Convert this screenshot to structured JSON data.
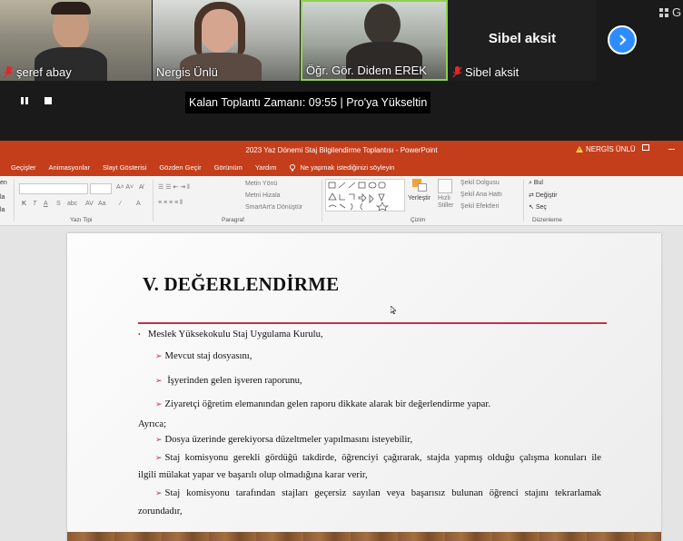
{
  "zoom": {
    "participants": [
      {
        "name": "şeref abay",
        "muted": true
      },
      {
        "name": "Nergis Ünlü",
        "muted": false
      },
      {
        "name": "Öğr. Gör. Didem EREK",
        "muted": true,
        "active_speaker": true
      },
      {
        "name": "Sibel aksit",
        "muted": true
      }
    ],
    "grid_label": "G",
    "meeting_time": "Kalan Toplantı Zamanı: 09:55 | Pro'ya Yükseltin"
  },
  "powerpoint": {
    "window_title": "2023 Yaz Dönemi Staj Bilgilendirme Toplantısı  -  PowerPoint",
    "user": "NERGİS ÜNLÜ",
    "tabs": [
      "Geçişler",
      "Animasyonlar",
      "Slayt Gösterisi",
      "Gözden Geçir",
      "Görünüm",
      "Yardım"
    ],
    "tell_me": "Ne yapmak istediğinizi söyleyin",
    "ribbon": {
      "left_clip": [
        "en",
        "la",
        "la"
      ],
      "groups": [
        "Yazı Tipi",
        "Paragraf",
        "Çizim",
        "Düzenleme"
      ],
      "paragraph": {
        "text_direction": "Metin Yönü",
        "align_text": "Metni Hizala",
        "smartart": "SmartArt'a Dönüştür"
      },
      "drawing": {
        "arrange": "Yerleştir",
        "quick_styles": "Hızlı Stiller",
        "shape_fill": "Şekil Dolgusu",
        "shape_outline": "Şekil Ana Hattı",
        "shape_effects": "Şekil Efektleri"
      },
      "editing": {
        "find": "Bul",
        "replace": "Değiştir",
        "select": "Seç"
      }
    }
  },
  "slide": {
    "title": "V. DEĞERLENDİRME",
    "bullet": "Meslek Yüksekokulu Staj Uygulama Kurulu,",
    "items": [
      "Mevcut staj dosyasını,",
      "İşyerinden gelen işveren raporunu,",
      "Ziyaretçi öğretim elemanından gelen raporu dikkate alarak bir değerlendirme yapar."
    ],
    "also": "Ayrıca;",
    "extra_1": "Dosya üzerinde gerekiyorsa düzeltmeler yapılmasını isteyebilir,",
    "extra_2_line1": "Staj komisyonu gerekli gördüğü takdirde, öğrenciyi çağırarak, stajda yapmış olduğu çalışma konuları ile",
    "extra_2_line2": "ilgili mülakat yapar ve başarılı olup olmadığına karar verir,",
    "extra_3_line1": "Staj komisyonu tarafından stajları geçersiz sayılan veya başarısız bulunan öğrenci stajını tekrarlamak",
    "extra_3_line2": "zorundadır,"
  }
}
